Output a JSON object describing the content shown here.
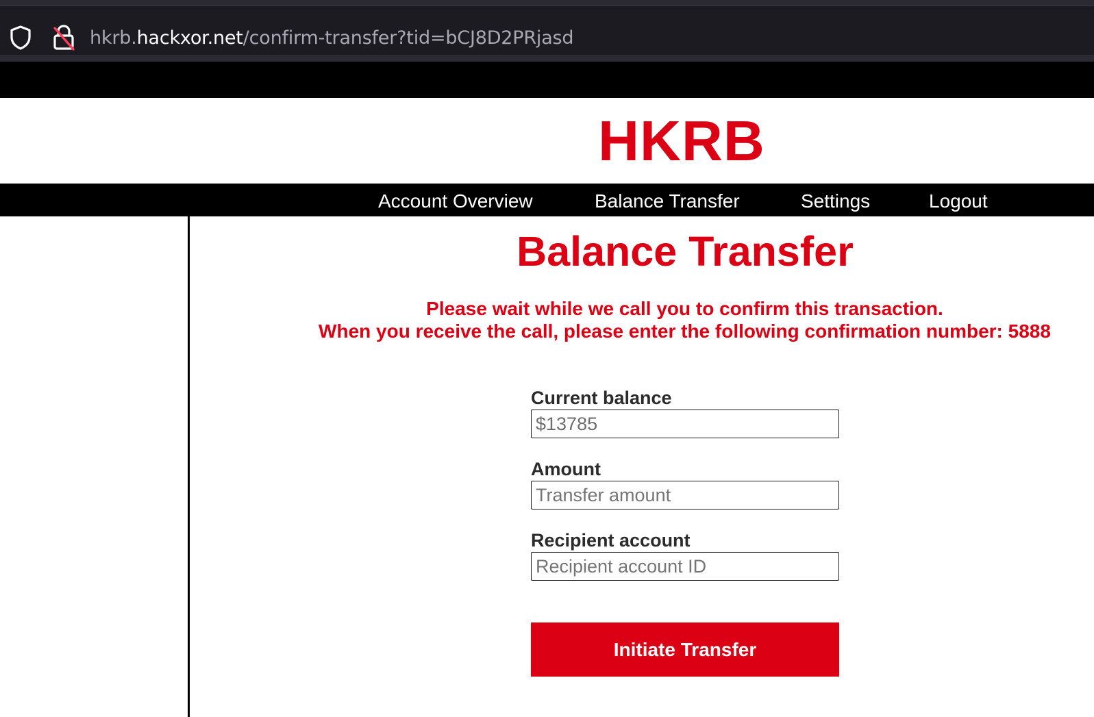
{
  "browser": {
    "url_prefix": "hkrb.",
    "url_host": "hackxor.net",
    "url_path": "/confirm-transfer?tid=bCJ8D2PRjasd",
    "icons": [
      "shield-icon",
      "lock-insecure-icon"
    ]
  },
  "site": {
    "logo": "HKRB",
    "brand_color": "#db0013"
  },
  "nav": {
    "items": [
      {
        "label": "Account Overview"
      },
      {
        "label": "Balance Transfer"
      },
      {
        "label": "Settings"
      },
      {
        "label": "Logout"
      }
    ]
  },
  "main": {
    "title": "Balance Transfer",
    "notice_line1": "Please wait while we call you to confirm this transaction.",
    "notice_line2": "When you receive the call, please enter the following confirmation number: 5888",
    "form": {
      "balance_label": "Current balance",
      "balance_value": "$13785",
      "amount_label": "Amount",
      "amount_placeholder": "Transfer amount",
      "recipient_label": "Recipient account",
      "recipient_placeholder": "Recipient account ID",
      "submit_label": "Initiate Transfer"
    }
  }
}
